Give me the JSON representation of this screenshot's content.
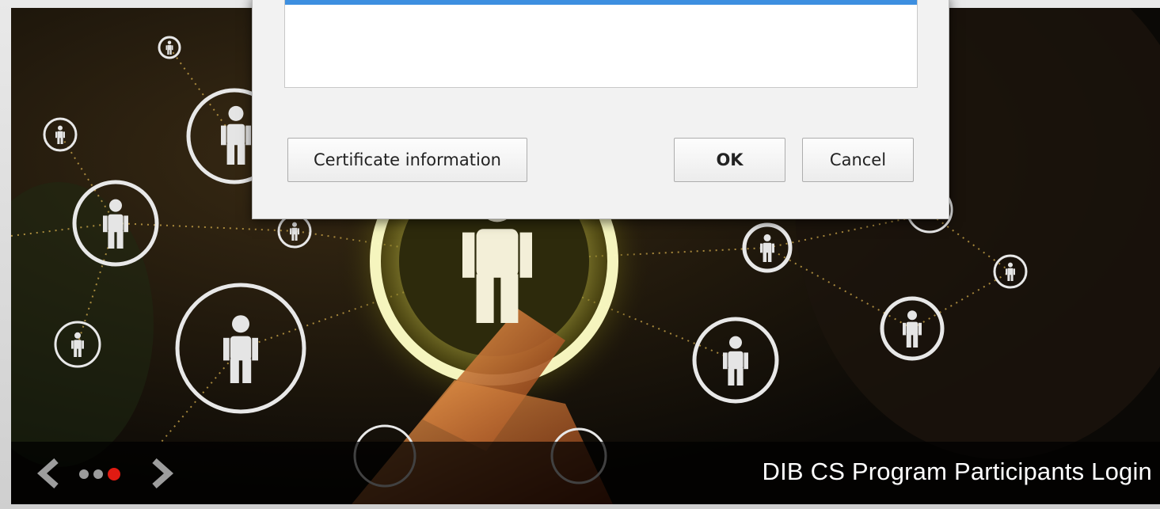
{
  "dialog": {
    "buttons": {
      "certificate_info": "Certificate information",
      "ok": "OK",
      "cancel": "Cancel"
    }
  },
  "slider": {
    "caption": "DIB CS Program Participants Login",
    "dots": 3,
    "active_dot": 3,
    "icons": {
      "prev": "chevron-left-icon",
      "next": "chevron-right-icon"
    }
  },
  "colors": {
    "selection": "#3d8fe0",
    "active_dot": "#e01b12",
    "inactive_dot": "#9b9b9b",
    "caption_text": "#ffffff"
  }
}
